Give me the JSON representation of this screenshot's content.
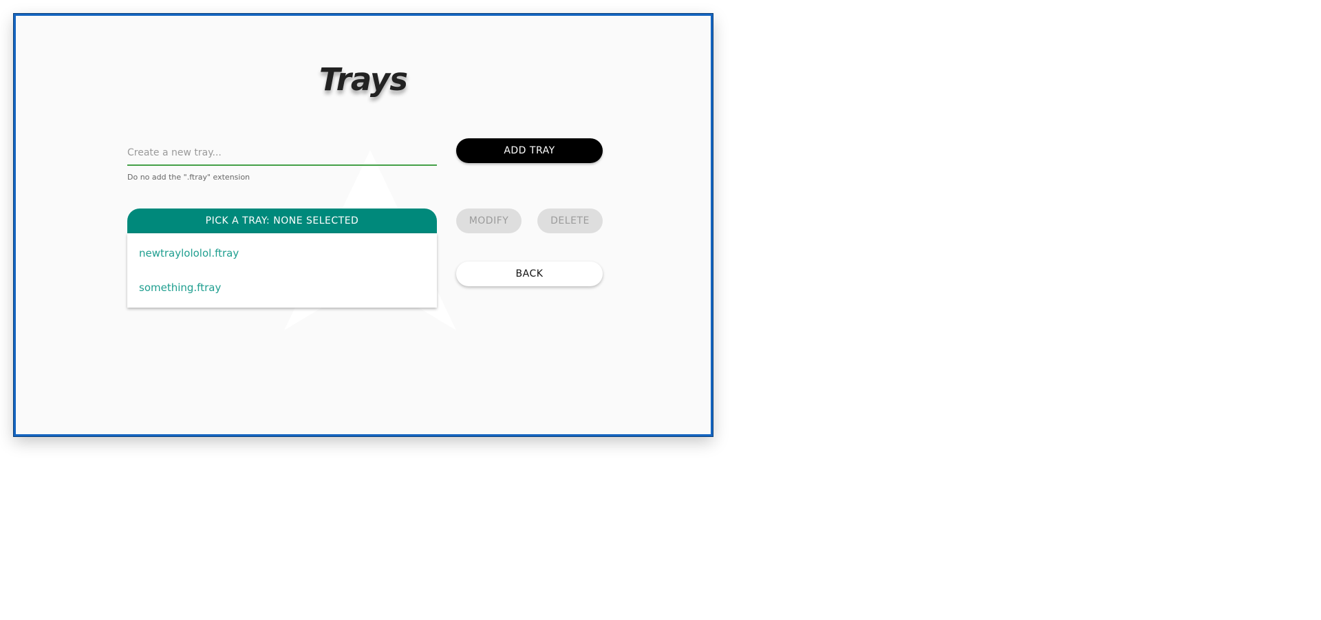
{
  "page": {
    "title": "Trays"
  },
  "new_tray": {
    "placeholder": "Create a new tray...",
    "value": "",
    "hint": "Do no add the \".ftray\" extension",
    "add_label": "ADD TRAY"
  },
  "picker": {
    "label": "PICK A TRAY: NONE SELECTED",
    "items": [
      {
        "label": "newtraylololol.ftray"
      },
      {
        "label": "something.ftray"
      }
    ]
  },
  "actions": {
    "modify_label": "MODIFY",
    "delete_label": "DELETE",
    "back_label": "BACK"
  },
  "colors": {
    "window_border": "#1565c0",
    "accent_teal": "#00897b",
    "input_underline": "#43a047",
    "primary_button": "#000000",
    "disabled_button": "#dedede"
  },
  "icons": {
    "watermark": "arch-logo-watermark"
  }
}
